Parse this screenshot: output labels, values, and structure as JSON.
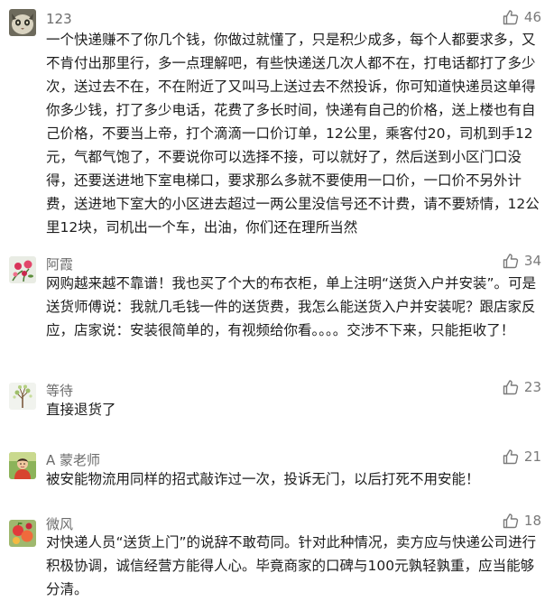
{
  "comments": [
    {
      "user": "123",
      "likes": "46",
      "text": "一个快递赚不了你几个钱，你做过就懂了，只是积少成多，每个人都要求多，又不肯付出那里行，多一点理解吧，有些快递送几次人都不在，打电话都打了多少次，送过去不在，不在附近了又叫马上送过去不然投诉，你可知道快递员这单得你多少钱，打了多少电话，花费了多长时间，快递有自己的价格，送上楼也有自己价格，不要当上帝，打个滴滴一口价订单，12公里，乘客付20，司机到手12元，气都气饱了，不要说你可以选择不接，可以就好了，然后送到小区门口没得，还要送进地下室电梯口，要求那么多就不要使用一口价，一口价不另外计费，送进地下室大的小区进去超过一两公里没信号还不计费，请不要矫情，12公里12块，司机出一个车，出油，你们还在理所当然",
      "avatar_icon": "cat-avatar-icon"
    },
    {
      "user": "阿霞",
      "likes": "34",
      "text": "网购越来越不靠谱！我也买了个大的布衣柜，单上注明“送货入户并安装”。可是送货师傅说：我就几毛钱一件的送货费，我怎么能送货入户并安装呢？跟店家反应，店家说：安装很简单的，有视频给你看。。。。交涉不下来，只能拒收了！",
      "avatar_icon": "flower-avatar-icon"
    },
    {
      "user": "等待",
      "likes": "23",
      "text": "直接退货了",
      "avatar_icon": "tree-avatar-icon"
    },
    {
      "user": "A 蒙老师",
      "likes": "21",
      "text": "被安能物流用同样的招式敲诈过一次，投诉无门，以后打死不用安能！",
      "avatar_icon": "child-avatar-icon"
    },
    {
      "user": "微风",
      "likes": "18",
      "text": "对快递人员“送货上门”的说辞不敢苟同。针对此种情况，卖方应与快递公司进行积极协调，诚信经营方能得人心。毕竟商家的口碑与100元孰轻孰重，应当能够分清。",
      "avatar_icon": "fruit-avatar-icon"
    }
  ],
  "colors": {
    "name": "#6c6c6c",
    "text": "#1d1d1d",
    "like": "#7a7a7a"
  }
}
